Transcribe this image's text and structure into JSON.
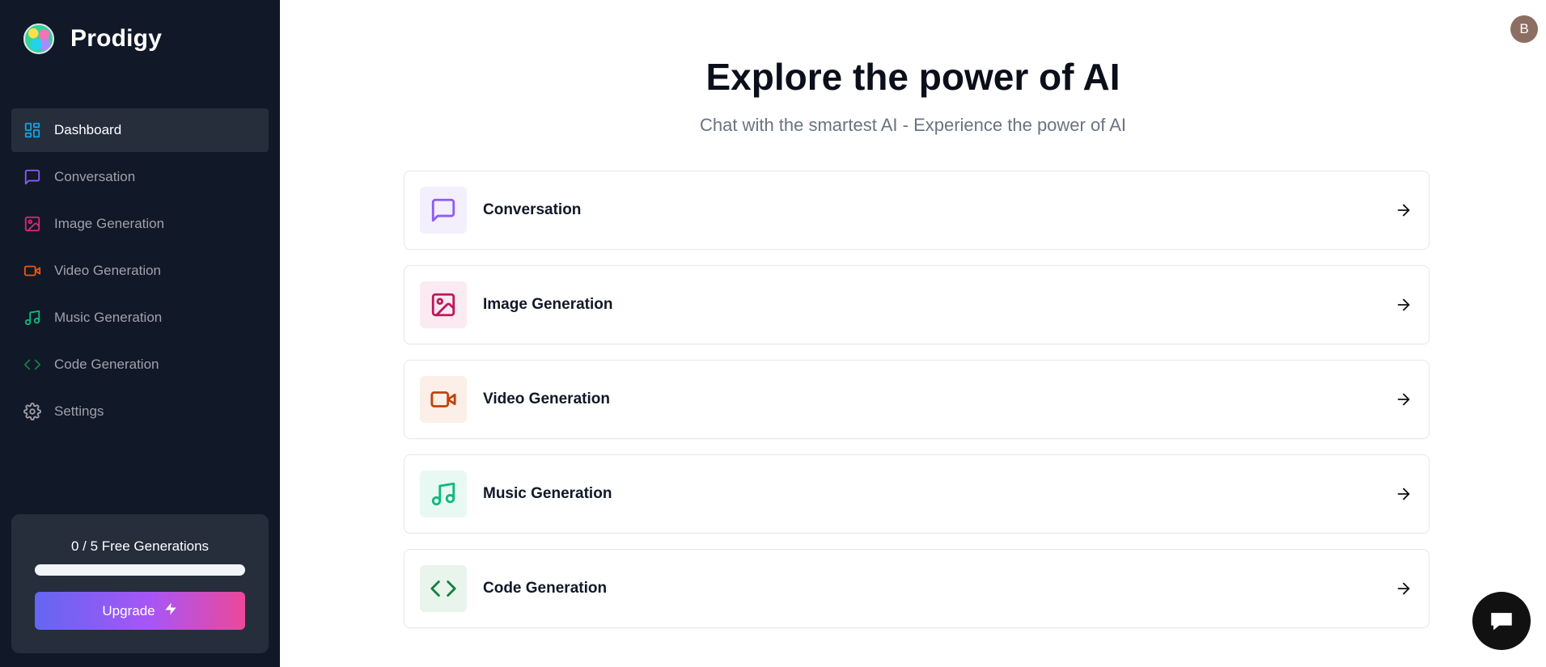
{
  "app": {
    "name": "Prodigy"
  },
  "sidebar": {
    "items": [
      {
        "label": "Dashboard",
        "icon": "dashboard-icon",
        "color": "#0ea5e9",
        "active": true
      },
      {
        "label": "Conversation",
        "icon": "message-square-icon",
        "color": "#8b5cf6",
        "active": false
      },
      {
        "label": "Image Generation",
        "icon": "image-icon",
        "color": "#db2777",
        "active": false
      },
      {
        "label": "Video Generation",
        "icon": "video-icon",
        "color": "#ea580c",
        "active": false
      },
      {
        "label": "Music Generation",
        "icon": "music-icon",
        "color": "#10b981",
        "active": false
      },
      {
        "label": "Code Generation",
        "icon": "code-icon",
        "color": "#15803d",
        "active": false
      },
      {
        "label": "Settings",
        "icon": "gear-icon",
        "color": "#a1a1aa",
        "active": false
      }
    ],
    "free_generations": {
      "text": "0 / 5 Free Generations",
      "used": 0,
      "limit": 5
    },
    "upgrade_label": "Upgrade"
  },
  "header": {
    "avatar_initial": "B"
  },
  "main": {
    "title": "Explore the power of AI",
    "subtitle": "Chat with the smartest AI - Experience the power of AI",
    "tools": [
      {
        "label": "Conversation",
        "icon": "message-square-icon",
        "color": "#8b5cf6",
        "bg": "#f3effd"
      },
      {
        "label": "Image Generation",
        "icon": "image-icon",
        "color": "#be185d",
        "bg": "#fbeaf1"
      },
      {
        "label": "Video Generation",
        "icon": "video-icon",
        "color": "#c2410c",
        "bg": "#fcefe7"
      },
      {
        "label": "Music Generation",
        "icon": "music-icon",
        "color": "#10b981",
        "bg": "#e8f8f2"
      },
      {
        "label": "Code Generation",
        "icon": "code-icon",
        "color": "#15803d",
        "bg": "#e9f4ec"
      }
    ]
  },
  "colors": {
    "sidebar_bg": "#111827",
    "accent_gradient": [
      "#6366f1",
      "#a855f7",
      "#ec4899"
    ]
  }
}
